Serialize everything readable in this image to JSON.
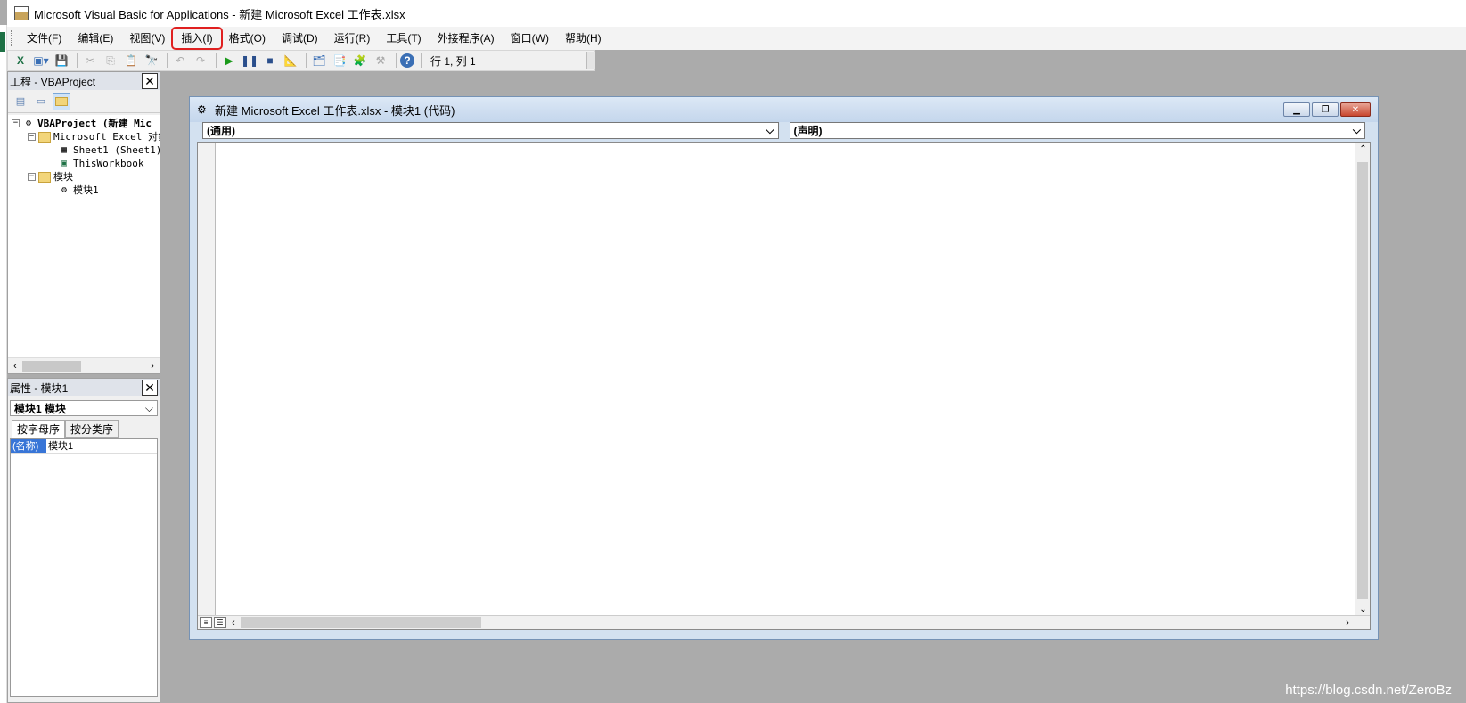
{
  "window": {
    "title": "Microsoft Visual Basic for Applications - 新建 Microsoft Excel 工作表.xlsx"
  },
  "menu": [
    "文件(F)",
    "编辑(E)",
    "视图(V)",
    "插入(I)",
    "格式(O)",
    "调试(D)",
    "运行(R)",
    "工具(T)",
    "外接程序(A)",
    "窗口(W)",
    "帮助(H)"
  ],
  "menu_highlight": "插入(I)",
  "toolbar": {
    "status": "行 1, 列 1"
  },
  "project": {
    "title": "工程 - VBAProject",
    "tree": [
      {
        "label": "VBAProject (新建 Mic",
        "bold": true
      },
      {
        "label": "Microsoft Excel 对象"
      },
      {
        "label": "Sheet1 (Sheet1)"
      },
      {
        "label": "ThisWorkbook"
      },
      {
        "label": "模块"
      },
      {
        "label": "模块1"
      }
    ]
  },
  "properties": {
    "title": "属性 - 模块1",
    "object": "模块1  模块",
    "tabs": [
      "按字母序",
      "按分类序"
    ],
    "rows": [
      {
        "key": "(名称)",
        "value": "模块1"
      }
    ]
  },
  "code_window": {
    "title": "新建 Microsoft Excel 工作表.xlsx - 模块1 (代码)",
    "object_combo": "(通用)",
    "proc_combo": "(声明)"
  },
  "watermark": "https://blog.csdn.net/ZeroBz"
}
